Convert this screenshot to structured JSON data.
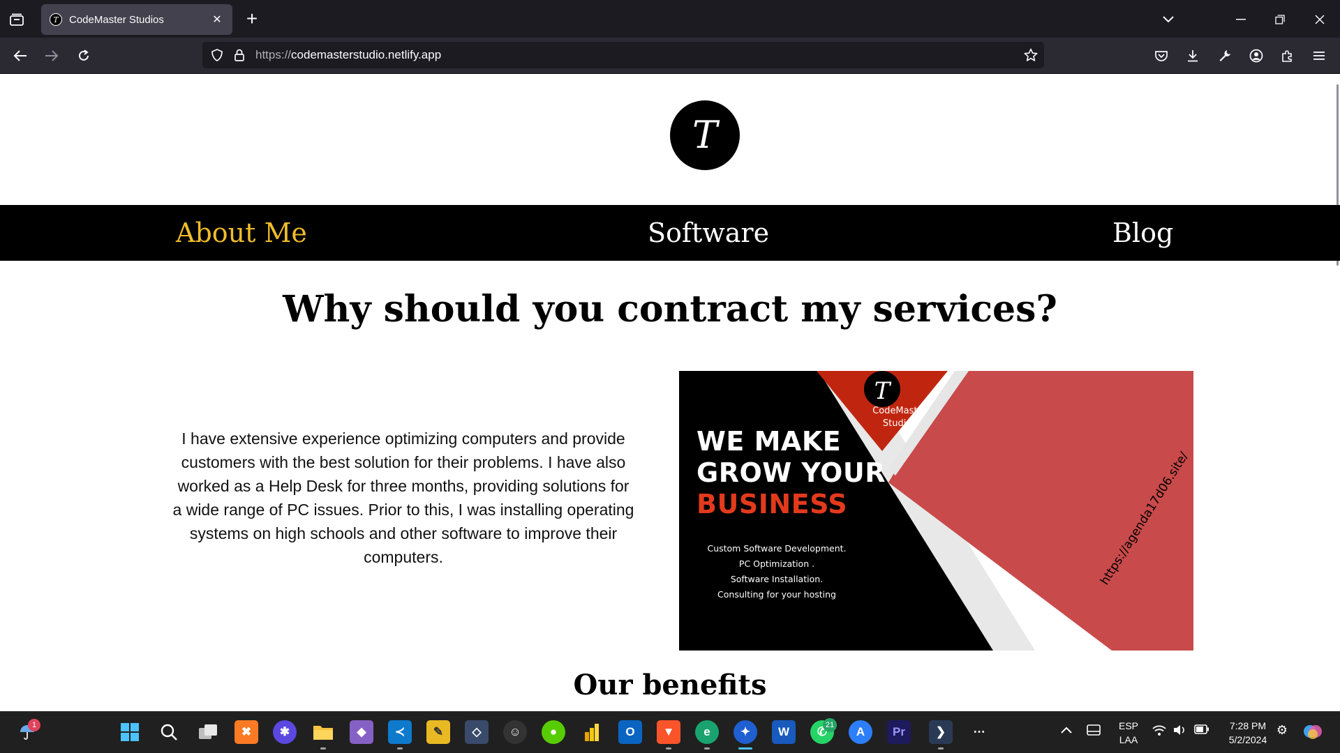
{
  "browser": {
    "tab_title": "CodeMaster Studios",
    "tab_close": "✕",
    "new_tab": "+",
    "url_scheme": "https://",
    "url_host": "codemasterstudio.netlify.app"
  },
  "site": {
    "logo_letter": "T",
    "nav": [
      "About Me",
      "Software",
      "Blog"
    ],
    "heading": "Why should you contract my services?",
    "intro": "I have extensive experience optimizing computers and provide customers with the best solution for their problems. I have also worked as a Help Desk for three months, providing solutions for a wide range of PC issues. Prior to this, I was installing operating systems on high schools and other software to improve their computers.",
    "promo": {
      "brand": "CodeMaster Studios",
      "line1": "WE MAKE",
      "line2": "GROW YOUR",
      "line3": "BUSINESS",
      "services": [
        "Custom Software Development.",
        "PC Optimization .",
        "Software Installation.",
        "Consulting for your hosting"
      ],
      "url": "https://agenda17d06.site/"
    },
    "benefits_heading": "Our benefits"
  },
  "taskbar": {
    "weather_badge": "1",
    "whatsapp_badge": "21",
    "lang_top": "ESP",
    "lang_bottom": "LAA",
    "time": "7:28 PM",
    "date": "5/2/2024"
  },
  "colors": {
    "nav_active": "#f0bd2a",
    "promo_red": "#c94a4a",
    "promo_accent": "#e33a1c"
  }
}
